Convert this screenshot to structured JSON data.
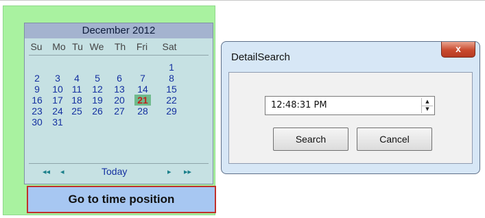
{
  "calendar": {
    "month_title": "December 2012",
    "weekdays": [
      "Su",
      "Mo",
      "Tu",
      "We",
      "Th",
      "Fri",
      "Sat"
    ],
    "weeks": [
      [
        "",
        "",
        "",
        "",
        "",
        "",
        "1"
      ],
      [
        "2",
        "3",
        "4",
        "5",
        "6",
        "7",
        "8"
      ],
      [
        "9",
        "10",
        "11",
        "12",
        "13",
        "14",
        "15"
      ],
      [
        "16",
        "17",
        "18",
        "19",
        "20",
        "21",
        "22"
      ],
      [
        "23",
        "24",
        "25",
        "26",
        "27",
        "28",
        "29"
      ],
      [
        "30",
        "31",
        "",
        "",
        "",
        "",
        ""
      ]
    ],
    "today_label": "Today",
    "nav_prev_year": "◂◂",
    "nav_prev_month": "◂",
    "nav_next_month": "▸",
    "nav_next_year": "▸▸"
  },
  "goto_button_label": "Go to time position",
  "dialog": {
    "title": "DetailSearch",
    "close_label": "x",
    "time_value": "12:48:31 PM",
    "search_label": "Search",
    "cancel_label": "Cancel"
  }
}
